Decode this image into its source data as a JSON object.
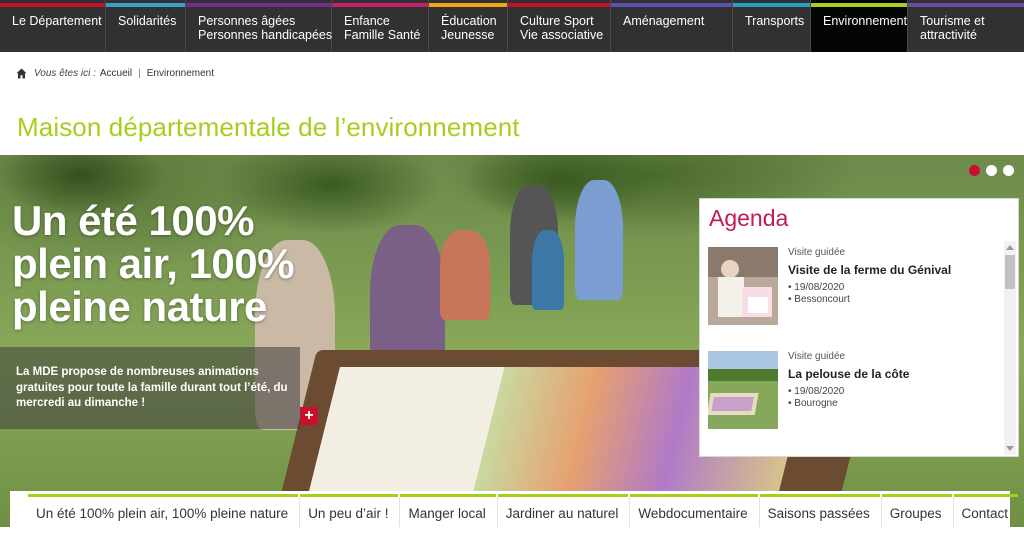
{
  "topnav": {
    "items": [
      {
        "line1": "Le Département",
        "line2": "",
        "color": "#c8102e"
      },
      {
        "line1": "Solidarités",
        "line2": "",
        "color": "#3aa0c8"
      },
      {
        "line1": "Personnes âgées",
        "line2": "Personnes handicapées",
        "color": "#7a2a8a"
      },
      {
        "line1": "Enfance",
        "line2": "Famille Santé",
        "color": "#c2246b"
      },
      {
        "line1": "Éducation",
        "line2": "Jeunesse",
        "color": "#f0a818"
      },
      {
        "line1": "Culture Sport",
        "line2": "Vie associative",
        "color": "#c8102e"
      },
      {
        "line1": "Aménagement",
        "line2": "",
        "color": "#5a50b0"
      },
      {
        "line1": "Transports",
        "line2": "",
        "color": "#2aa0c0"
      },
      {
        "line1": "Environnement",
        "line2": "",
        "color": "#a5cf1c"
      },
      {
        "line1": "Tourisme et",
        "line2": "attractivité",
        "color": "#6a4aa8"
      }
    ]
  },
  "breadcrumb": {
    "prefix": "Vous êtes ici :",
    "home": "Accueil",
    "separator": "|",
    "current": "Environnement"
  },
  "page_title": "Maison départementale de l’environnement",
  "hero": {
    "headline": "Un été 100% plein air, 100% pleine nature",
    "text": "La MDE propose de nombreuses animations gratuites pour toute la famille durant tout l’été, du mercredi au dimanche !",
    "plus": "+"
  },
  "agenda": {
    "title": "Agenda",
    "items": [
      {
        "category": "Visite guidée",
        "title": "Visite de la ferme du Génival",
        "date": "• 19/08/2020",
        "place": "• Bessoncourt"
      },
      {
        "category": "Visite guidée",
        "title": "La pelouse de la côte",
        "date": "• 19/08/2020",
        "place": "• Bourogne"
      }
    ]
  },
  "subnav": {
    "items": [
      "Un été 100% plein air, 100% pleine nature",
      "Un peu d’air !",
      "Manger local",
      "Jardiner au naturel",
      "Webdocumentaire",
      "Saisons passées",
      "Groupes",
      "Contact"
    ]
  },
  "colors": {
    "accent_green": "#a5cf1c",
    "agenda_magenta": "#c3185a",
    "nav_bg": "#313131",
    "red": "#c8102e"
  }
}
